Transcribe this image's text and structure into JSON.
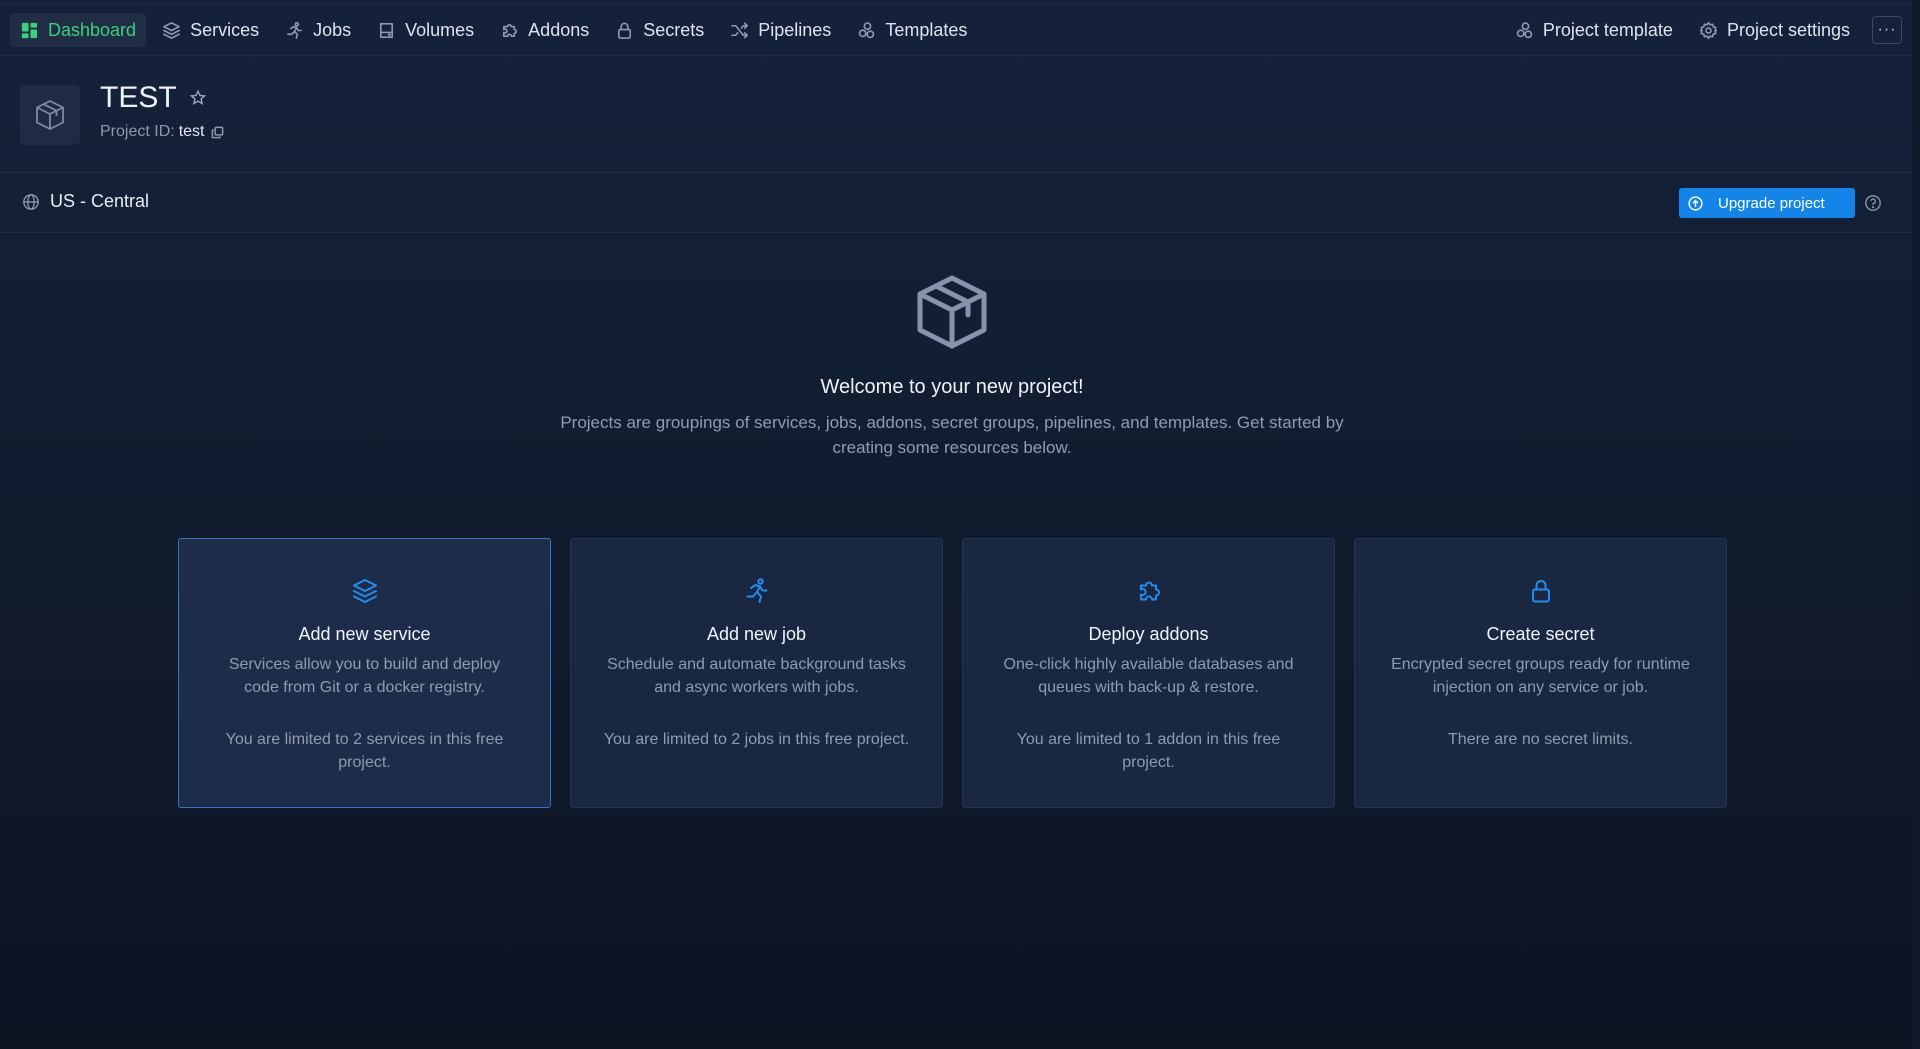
{
  "nav": {
    "items": [
      {
        "label": "Dashboard",
        "icon": "dashboard-icon"
      },
      {
        "label": "Services",
        "icon": "layers-icon"
      },
      {
        "label": "Jobs",
        "icon": "running-icon"
      },
      {
        "label": "Volumes",
        "icon": "drive-icon"
      },
      {
        "label": "Addons",
        "icon": "puzzle-icon"
      },
      {
        "label": "Secrets",
        "icon": "lock-icon"
      },
      {
        "label": "Pipelines",
        "icon": "shuffle-icon"
      },
      {
        "label": "Templates",
        "icon": "templates-icon"
      }
    ],
    "right": {
      "project_template": "Project template",
      "project_settings": "Project settings",
      "more": "···"
    },
    "active_color": "#3ccf7c"
  },
  "project": {
    "name": "TEST",
    "id_label": "Project ID:",
    "id_value": "test"
  },
  "region": {
    "label": "US - Central"
  },
  "upgrade": {
    "label": "Upgrade project",
    "color": "#1485e8"
  },
  "welcome": {
    "title": "Welcome to your new project!",
    "description": "Projects are groupings of services, jobs, addons, secret groups, pipelines, and templates. Get started by creating some resources below."
  },
  "cards": [
    {
      "title": "Add new service",
      "description": "Services allow you to build and deploy code from Git or a docker registry.",
      "limit": "You are limited to 2 services in this free project.",
      "icon": "layers-icon",
      "selected": true
    },
    {
      "title": "Add new job",
      "description": "Schedule and automate background tasks and async workers with jobs.",
      "limit": "You are limited to 2 jobs in this free project.",
      "icon": "running-icon"
    },
    {
      "title": "Deploy addons",
      "description": "One-click highly available databases and queues with back-up & restore.",
      "limit": "You are limited to 1 addon in this free project.",
      "icon": "puzzle-icon"
    },
    {
      "title": "Create secret",
      "description": "Encrypted secret groups ready for runtime injection on any service or job.",
      "limit": "There are no secret limits.",
      "icon": "lock-icon"
    }
  ],
  "accent_color": "#1f8ef1"
}
